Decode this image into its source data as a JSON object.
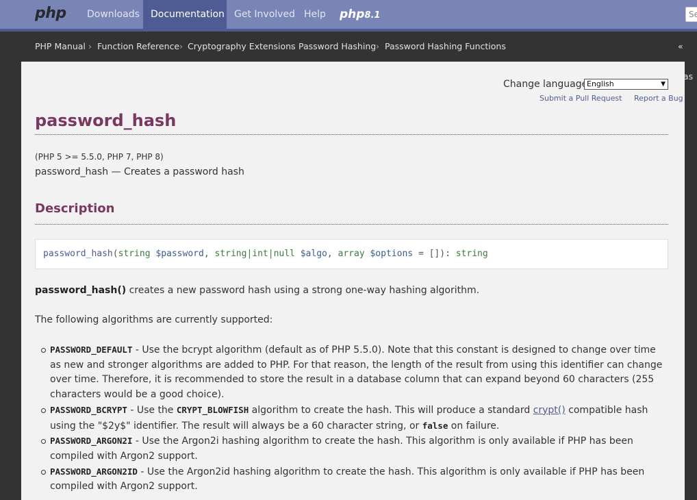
{
  "nav": {
    "logo": "php",
    "items": [
      "Downloads",
      "Documentation",
      "Get Involved",
      "Help"
    ],
    "active": "Documentation",
    "badge_main": "php",
    "badge_version": "8.1",
    "search_placeholder": "Se"
  },
  "breadcrumbs": [
    "PHP Manual",
    "Function Reference",
    "Cryptography Extensions",
    "Password Hashing",
    "Password Hashing Functions"
  ],
  "breadcrumb_prev": "« pas",
  "language": {
    "label": "Change language:",
    "selected": "English",
    "links": [
      "Submit a Pull Request",
      "Report a Bug"
    ]
  },
  "page": {
    "title": "password_hash",
    "versions": "(PHP 5 >= 5.5.0, PHP 7, PHP 8)",
    "refname": "password_hash — Creates a password hash",
    "section_title": "Description",
    "signature": {
      "fn": "password_hash",
      "p1_type": "string",
      "p1_var": "$password",
      "p2_type": "string|int|null",
      "p2_var": "$algo",
      "p3_type": "array",
      "p3_var": "$options",
      "p3_default": "= []",
      "return_type": "string"
    },
    "intro_fn": "password_hash()",
    "intro_text": " creates a new password hash using a strong one-way hashing algorithm.",
    "supported": "The following algorithms are currently supported:",
    "algos": [
      {
        "const": "PASSWORD_DEFAULT",
        "text": " - Use the bcrypt algorithm (default as of PHP 5.5.0). Note that this constant is designed to change over time as new and stronger algorithms are added to PHP. For that reason, the length of the result from using this identifier can change over time. Therefore, it is recommended to store the result in a database column that can expand beyond 60 characters (255 characters would be a good choice)."
      },
      {
        "const": "PASSWORD_BCRYPT",
        "text_a": " - Use the ",
        "const2": "CRYPT_BLOWFISH",
        "text_b": " algorithm to create the hash. This will produce a standard ",
        "link": "crypt()",
        "text_c": " compatible hash using the \"$2y$\" identifier. The result will always be a 60 character string, or ",
        "false": "false",
        "text_d": " on failure."
      },
      {
        "const": "PASSWORD_ARGON2I",
        "text": " - Use the Argon2i hashing algorithm to create the hash. This algorithm is only available if PHP has been compiled with Argon2 support."
      },
      {
        "const": "PASSWORD_ARGON2ID",
        "text": " - Use the Argon2id hashing algorithm to create the hash. This algorithm is only available if PHP has been compiled with Argon2 support."
      }
    ]
  },
  "colors": {
    "nav_bg": "#7a85b7",
    "nav_active": "#4f5b93",
    "title": "#793862",
    "link": "#4f5b93"
  }
}
